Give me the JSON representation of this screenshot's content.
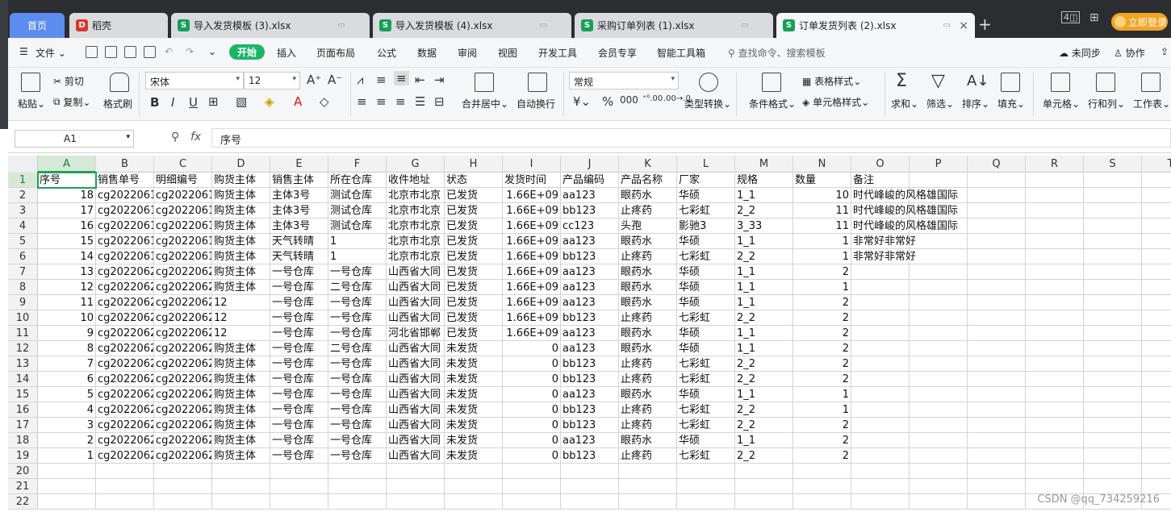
{
  "tabs": [
    {
      "label": "首页",
      "type": "home"
    },
    {
      "label": "稻壳",
      "type": "daoke"
    },
    {
      "label": "导入发货模板 (3).xlsx",
      "type": "sheet"
    },
    {
      "label": "导入发货模板 (4).xlsx",
      "type": "sheet"
    },
    {
      "label": "采购订单列表 (1).xlsx",
      "type": "sheet"
    },
    {
      "label": "订单发货列表 (2).xlsx",
      "type": "sheet",
      "active": true
    }
  ],
  "window": {
    "login_label": "立即登录",
    "tab_count": "4"
  },
  "menu": {
    "file": "文件",
    "items": [
      "开始",
      "插入",
      "页面布局",
      "公式",
      "数据",
      "审阅",
      "视图",
      "开发工具",
      "会员专享",
      "智能工具箱"
    ],
    "search": "查找命令、搜索模板",
    "sync": "未同步",
    "collab": "协作"
  },
  "ribbon": {
    "paste": "粘贴",
    "cut": "剪切",
    "copy": "复制",
    "format_painter": "格式刷",
    "font_name": "宋体",
    "font_size": "12",
    "merge": "合并居中",
    "wrap": "自动换行",
    "number_format": "常规",
    "convert": "类型转换",
    "cond_format": "条件格式",
    "table_style": "表格样式",
    "cell_style": "单元格样式",
    "sum": "求和",
    "filter": "筛选",
    "sort": "排序",
    "fill": "填充",
    "cell": "单元格",
    "rowcol": "行和列",
    "sheet": "工作表"
  },
  "formula": {
    "cell_ref": "A1",
    "fx": "fx",
    "value": "序号"
  },
  "columns": [
    "A",
    "B",
    "C",
    "D",
    "E",
    "F",
    "G",
    "H",
    "I",
    "J",
    "K",
    "L",
    "M",
    "N",
    "O",
    "P",
    "Q",
    "R",
    "S",
    "T"
  ],
  "rows": [
    [
      "序号",
      "销售单号",
      "明细编号",
      "购货主体",
      "销售主体",
      "所在仓库",
      "收件地址",
      "状态",
      "发货时间",
      "产品编码",
      "产品名称",
      "厂家",
      "规格",
      "数量",
      "备注"
    ],
    [
      "18",
      "cg2022061",
      "cg2022061",
      "购货主体",
      "主体3号",
      "测试仓库",
      "北京市北京",
      "已发货",
      "1.66E+09",
      "aa123",
      "眼药水",
      "华硕",
      "1_1",
      "10",
      "时代峰峻的风格雄国际"
    ],
    [
      "17",
      "cg2022061",
      "cg2022061",
      "购货主体",
      "主体3号",
      "测试仓库",
      "北京市北京",
      "已发货",
      "1.66E+09",
      "bb123",
      "止疼药",
      "七彩虹",
      "2_2",
      "11",
      "时代峰峻的风格雄国际"
    ],
    [
      "16",
      "cg2022061",
      "cg2022061",
      "购货主体",
      "主体3号",
      "测试仓库",
      "北京市北京",
      "已发货",
      "1.66E+09",
      "cc123",
      "头孢",
      "影驰3",
      "3_33",
      "11",
      "时代峰峻的风格雄国际"
    ],
    [
      "15",
      "cg2022061",
      "cg2022061",
      "购货主体",
      "天气转晴",
      "1",
      "北京市北京",
      "已发货",
      "1.66E+09",
      "aa123",
      "眼药水",
      "华硕",
      "1_1",
      "1",
      "非常好非常好"
    ],
    [
      "14",
      "cg2022061",
      "cg2022061",
      "购货主体",
      "天气转晴",
      "1",
      "北京市北京",
      "已发货",
      "1.66E+09",
      "bb123",
      "止疼药",
      "七彩虹",
      "2_2",
      "1",
      "非常好非常好"
    ],
    [
      "13",
      "cg2022062",
      "cg2022062",
      "购货主体",
      "一号仓库",
      "一号仓库",
      "山西省大同",
      "已发货",
      "1.66E+09",
      "aa123",
      "眼药水",
      "华硕",
      "1_1",
      "2",
      ""
    ],
    [
      "12",
      "cg2022062",
      "cg2022062",
      "购货主体",
      "一号仓库",
      "二号仓库",
      "山西省大同",
      "已发货",
      "1.66E+09",
      "aa123",
      "眼药水",
      "华硕",
      "1_1",
      "1",
      ""
    ],
    [
      "11",
      "cg2022062",
      "cg2022062",
      "12",
      "一号仓库",
      "一号仓库",
      "山西省大同",
      "已发货",
      "1.66E+09",
      "aa123",
      "眼药水",
      "华硕",
      "1_1",
      "2",
      ""
    ],
    [
      "10",
      "cg2022062",
      "cg2022062",
      "12",
      "一号仓库",
      "一号仓库",
      "山西省大同",
      "已发货",
      "1.66E+09",
      "bb123",
      "止疼药",
      "七彩虹",
      "2_2",
      "2",
      ""
    ],
    [
      "9",
      "cg2022062",
      "cg2022062",
      "12",
      "一号仓库",
      "一号仓库",
      "河北省邯郸",
      "已发货",
      "1.66E+09",
      "aa123",
      "眼药水",
      "华硕",
      "1_1",
      "2",
      ""
    ],
    [
      "8",
      "cg2022062",
      "cg2022062",
      "购货主体",
      "一号仓库",
      "二号仓库",
      "山西省大同",
      "未发货",
      "0",
      "aa123",
      "眼药水",
      "华硕",
      "1_1",
      "2",
      ""
    ],
    [
      "7",
      "cg2022062",
      "cg2022062",
      "购货主体",
      "一号仓库",
      "一号仓库",
      "山西省大同",
      "未发货",
      "0",
      "bb123",
      "止疼药",
      "七彩虹",
      "2_2",
      "2",
      ""
    ],
    [
      "6",
      "cg2022062",
      "cg2022062",
      "购货主体",
      "一号仓库",
      "一号仓库",
      "山西省大同",
      "未发货",
      "0",
      "bb123",
      "止疼药",
      "七彩虹",
      "2_2",
      "2",
      ""
    ],
    [
      "5",
      "cg2022062",
      "cg2022062",
      "购货主体",
      "一号仓库",
      "一号仓库",
      "山西省大同",
      "未发货",
      "0",
      "aa123",
      "眼药水",
      "华硕",
      "1_1",
      "1",
      ""
    ],
    [
      "4",
      "cg2022062",
      "cg2022062",
      "购货主体",
      "一号仓库",
      "一号仓库",
      "山西省大同",
      "未发货",
      "0",
      "bb123",
      "止疼药",
      "七彩虹",
      "2_2",
      "1",
      ""
    ],
    [
      "3",
      "cg2022062",
      "cg2022062",
      "购货主体",
      "一号仓库",
      "一号仓库",
      "山西省大同",
      "未发货",
      "0",
      "bb123",
      "止疼药",
      "七彩虹",
      "2_2",
      "2",
      ""
    ],
    [
      "2",
      "cg2022062",
      "cg2022062",
      "购货主体",
      "一号仓库",
      "一号仓库",
      "山西省大同",
      "未发货",
      "0",
      "aa123",
      "眼药水",
      "华硕",
      "1_1",
      "2",
      ""
    ],
    [
      "1",
      "cg2022062",
      "cg2022062",
      "购货主体",
      "一号仓库",
      "一号仓库",
      "山西省大同",
      "未发货",
      "0",
      "bb123",
      "止疼药",
      "七彩虹",
      "2_2",
      "2",
      ""
    ],
    [],
    [],
    []
  ],
  "watermark": "CSDN @qq_734259216"
}
